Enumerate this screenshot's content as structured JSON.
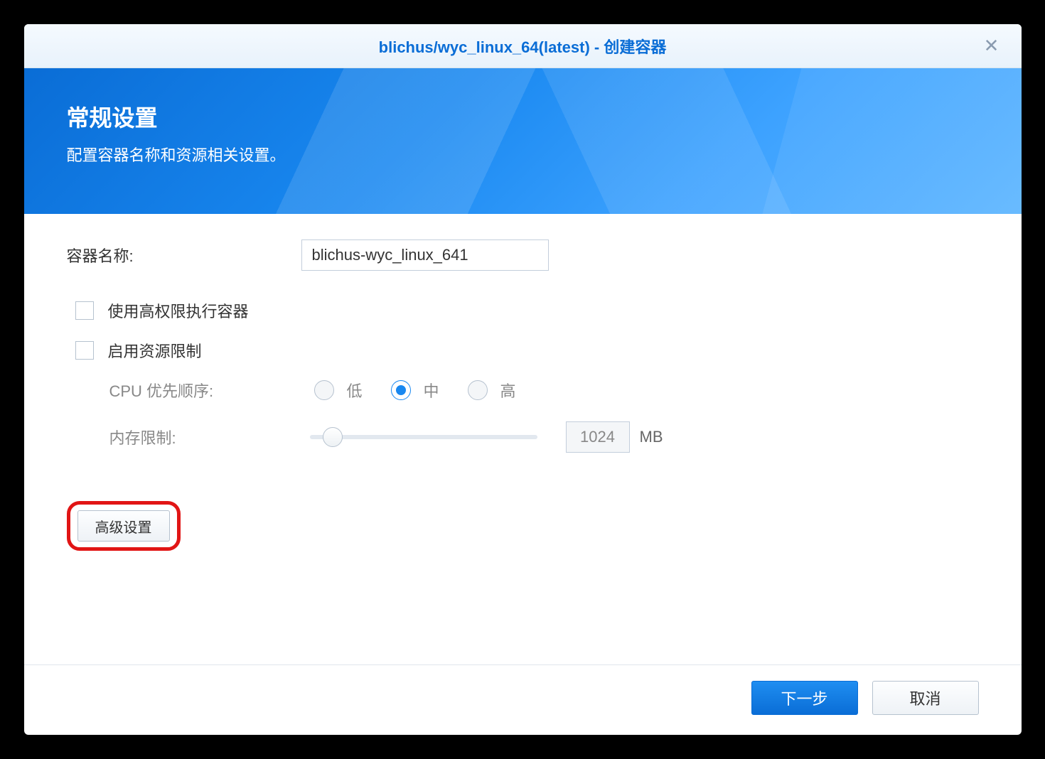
{
  "titlebar": {
    "title": "blichus/wyc_linux_64(latest) - 创建容器"
  },
  "banner": {
    "heading": "常规设置",
    "subheading": "配置容器名称和资源相关设置。"
  },
  "form": {
    "container_name_label": "容器名称:",
    "container_name_value": "blichus-wyc_linux_641",
    "privileged_label": "使用高权限执行容器",
    "resource_limit_label": "启用资源限制",
    "cpu_priority_label": "CPU 优先顺序:",
    "cpu_options": {
      "low": "低",
      "mid": "中",
      "high": "高"
    },
    "cpu_selected": "mid",
    "memory_limit_label": "内存限制:",
    "memory_value": "1024",
    "memory_unit": "MB",
    "advanced_button": "高级设置"
  },
  "footer": {
    "next": "下一步",
    "cancel": "取消"
  }
}
